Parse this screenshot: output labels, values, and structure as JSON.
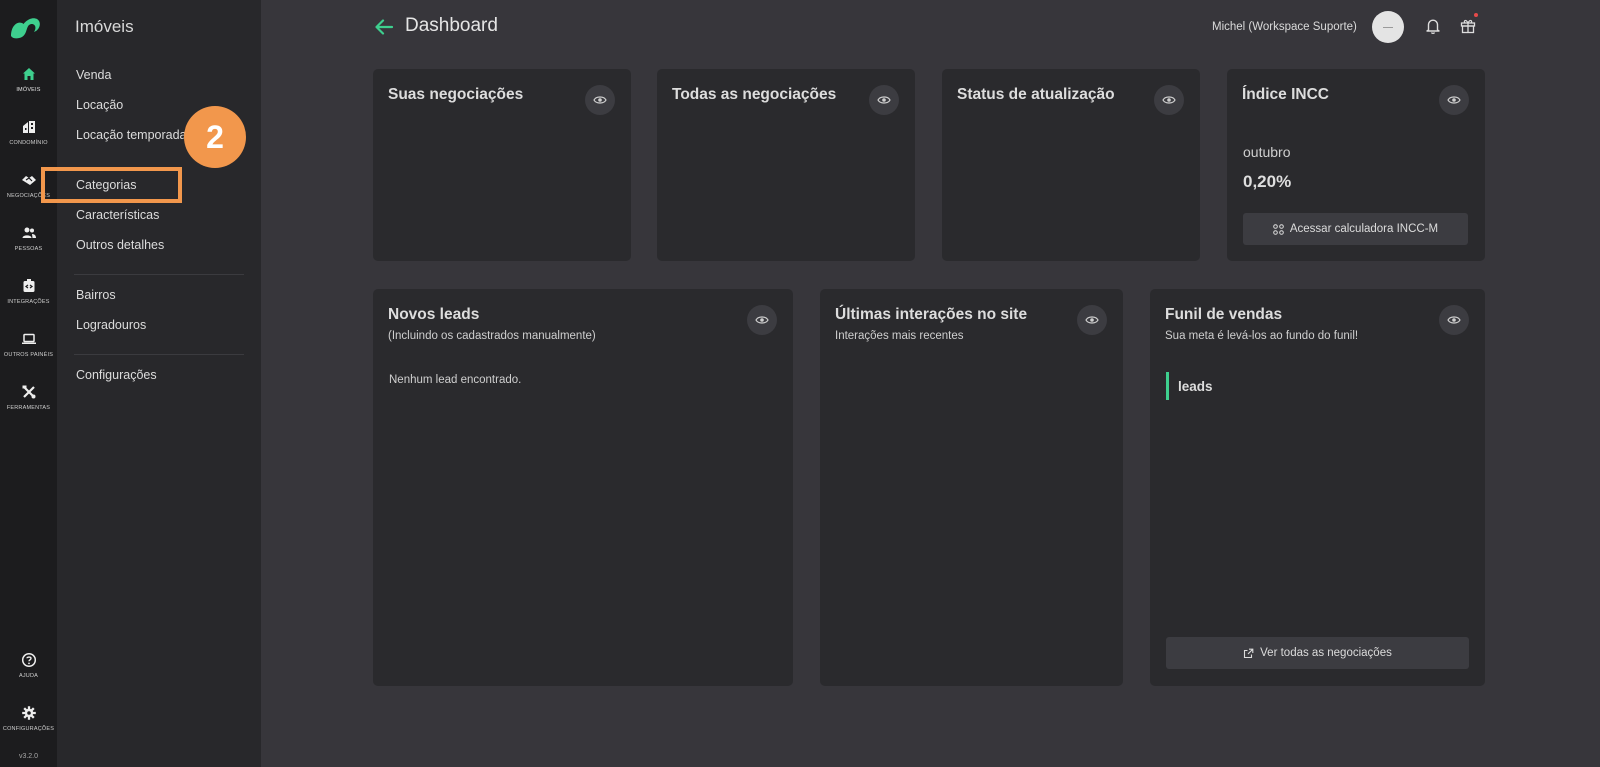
{
  "rail": {
    "items": [
      {
        "label": "IMÓVEIS",
        "icon": "home-icon"
      },
      {
        "label": "CONDOMÍNIO",
        "icon": "building-icon"
      },
      {
        "label": "NEGOCIAÇÕES",
        "icon": "handshake-icon"
      },
      {
        "label": "PESSOAS",
        "icon": "people-icon"
      },
      {
        "label": "INTEGRAÇÕES",
        "icon": "integrations-icon"
      },
      {
        "label": "OUTROS PAINÉIS",
        "icon": "laptop-icon"
      },
      {
        "label": "FERRAMENTAS",
        "icon": "tools-icon"
      },
      {
        "label": "AJUDA",
        "icon": "help-icon"
      },
      {
        "label": "CONFIGURAÇÕES",
        "icon": "gear-icon"
      }
    ],
    "version": "v3.2.0"
  },
  "subnav": {
    "title": "Imóveis",
    "items": [
      "Venda",
      "Locação",
      "Locação temporada",
      "Categorias",
      "Características",
      "Outros detalhes",
      "Bairros",
      "Logradouros",
      "Configurações"
    ]
  },
  "annotation": {
    "number": "2",
    "color": "#f2974c"
  },
  "header": {
    "title": "Dashboard",
    "user": "Michel (Workspace Suporte)"
  },
  "cards": {
    "suas_negociacoes": {
      "title": "Suas negociações"
    },
    "todas_negociacoes": {
      "title": "Todas as negociações"
    },
    "status_atualizacao": {
      "title": "Status de atualização"
    },
    "incc": {
      "title": "Índice INCC",
      "month": "outubro",
      "value": "0,20%",
      "button": "Acessar calculadora INCC-M"
    },
    "novos_leads": {
      "title": "Novos leads",
      "subtitle": "(Incluindo os cadastrados manualmente)",
      "empty": "Nenhum lead encontrado."
    },
    "ultimas_interacoes": {
      "title": "Últimas interações no site",
      "subtitle": "Interações mais recentes"
    },
    "funil": {
      "title": "Funil de vendas",
      "subtitle": "Sua meta é levá-los ao fundo do funil!",
      "stage": "leads",
      "button": "Ver todas as negociações"
    }
  },
  "colors": {
    "accent": "#3ecf8e",
    "background": "#37363b",
    "card": "#2a2a2d",
    "rail": "#1c1c1e",
    "subnav": "#28282b"
  }
}
